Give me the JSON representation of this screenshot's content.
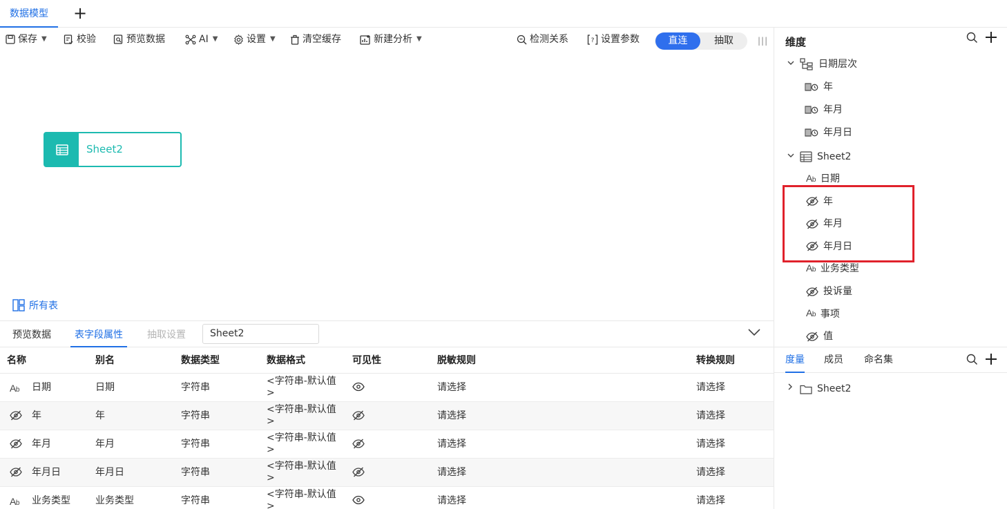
{
  "top_tab": {
    "label": "数据模型",
    "add": "+"
  },
  "toolbar": {
    "save": "保存",
    "validate": "校验",
    "preview": "预览数据",
    "ai": "AI",
    "settings": "设置",
    "clear_cache": "清空缓存",
    "new_analysis": "新建分析",
    "detect_relations": "检测关系",
    "set_params": "设置参数",
    "mode_direct": "直连",
    "mode_extract": "抽取",
    "caret": "⌄"
  },
  "canvas": {
    "node_label": "Sheet2",
    "all_tables": "所有表"
  },
  "bottom": {
    "tabs": [
      "预览数据",
      "表字段属性",
      "抽取设置"
    ],
    "table_select": "Sheet2",
    "headers": [
      "名称",
      "别名",
      "数据类型",
      "数据格式",
      "可见性",
      "脱敏规则",
      "转换规则"
    ],
    "rows": [
      {
        "type_icon": "text-type",
        "name": "日期",
        "alias": "日期",
        "dtype": "字符串",
        "format": "<字符串-默认值>",
        "visible": true,
        "mask": "请选择",
        "convert": "请选择"
      },
      {
        "type_icon": "hidden",
        "name": "年",
        "alias": "年",
        "dtype": "字符串",
        "format": "<字符串-默认值>",
        "visible": false,
        "mask": "请选择",
        "convert": "请选择"
      },
      {
        "type_icon": "hidden",
        "name": "年月",
        "alias": "年月",
        "dtype": "字符串",
        "format": "<字符串-默认值>",
        "visible": false,
        "mask": "请选择",
        "convert": "请选择"
      },
      {
        "type_icon": "hidden",
        "name": "年月日",
        "alias": "年月日",
        "dtype": "字符串",
        "format": "<字符串-默认值>",
        "visible": false,
        "mask": "请选择",
        "convert": "请选择"
      },
      {
        "type_icon": "text-type",
        "name": "业务类型",
        "alias": "业务类型",
        "dtype": "字符串",
        "format": "<字符串-默认值>",
        "visible": true,
        "mask": "请选择",
        "convert": "请选择"
      }
    ]
  },
  "right": {
    "dimension_title": "维度",
    "date_hierarchy": "日期层次",
    "date_children": [
      "年",
      "年月",
      "年月日"
    ],
    "sheet_group": "Sheet2",
    "sheet_fields": [
      {
        "icon": "text-type",
        "label": "日期"
      },
      {
        "icon": "hidden",
        "label": "年"
      },
      {
        "icon": "hidden",
        "label": "年月"
      },
      {
        "icon": "hidden",
        "label": "年月日"
      },
      {
        "icon": "text-type",
        "label": "业务类型"
      },
      {
        "icon": "hidden",
        "label": "投诉量"
      },
      {
        "icon": "text-type",
        "label": "事项"
      },
      {
        "icon": "hidden",
        "label": "值"
      }
    ],
    "measure_tabs": [
      "度量",
      "成员",
      "命名集"
    ],
    "measure_group": "Sheet2"
  },
  "colors": {
    "accent": "#1f6fe5",
    "node": "#1cbab0",
    "highlight": "#e0212b"
  }
}
